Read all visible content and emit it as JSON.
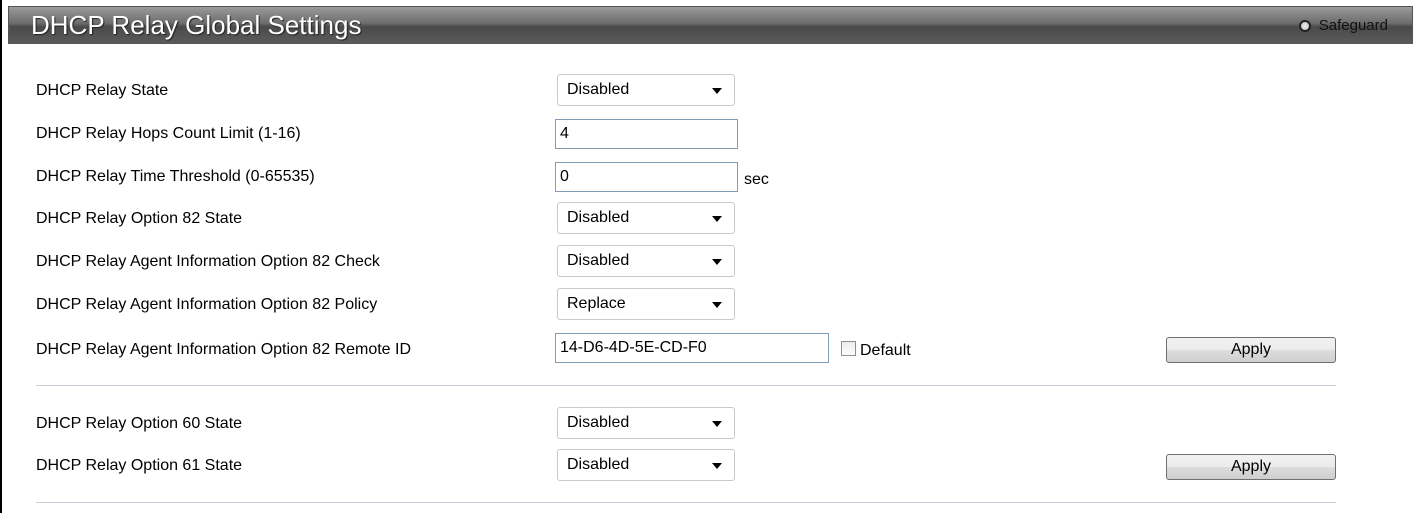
{
  "header": {
    "title": "DHCP Relay Global Settings",
    "safeguard_label": "Safeguard"
  },
  "section1": {
    "relay_state": {
      "label": "DHCP Relay State",
      "value": "Disabled"
    },
    "hops_limit": {
      "label": "DHCP Relay Hops Count Limit (1-16)",
      "value": "4"
    },
    "time_threshold": {
      "label": "DHCP Relay Time Threshold (0-65535)",
      "value": "0",
      "unit": "sec"
    },
    "opt82_state": {
      "label": "DHCP Relay Option 82 State",
      "value": "Disabled"
    },
    "opt82_check": {
      "label": "DHCP Relay Agent Information Option 82 Check",
      "value": "Disabled"
    },
    "opt82_policy": {
      "label": "DHCP Relay Agent Information Option 82 Policy",
      "value": "Replace"
    },
    "opt82_remote_id": {
      "label": "DHCP Relay Agent Information Option 82 Remote ID",
      "value": "14-D6-4D-5E-CD-F0",
      "default_label": "Default",
      "default_checked": false
    },
    "apply_label": "Apply"
  },
  "section2": {
    "opt60_state": {
      "label": "DHCP Relay Option 60 State",
      "value": "Disabled"
    },
    "opt61_state": {
      "label": "DHCP Relay Option 61 State",
      "value": "Disabled"
    },
    "apply_label": "Apply"
  }
}
